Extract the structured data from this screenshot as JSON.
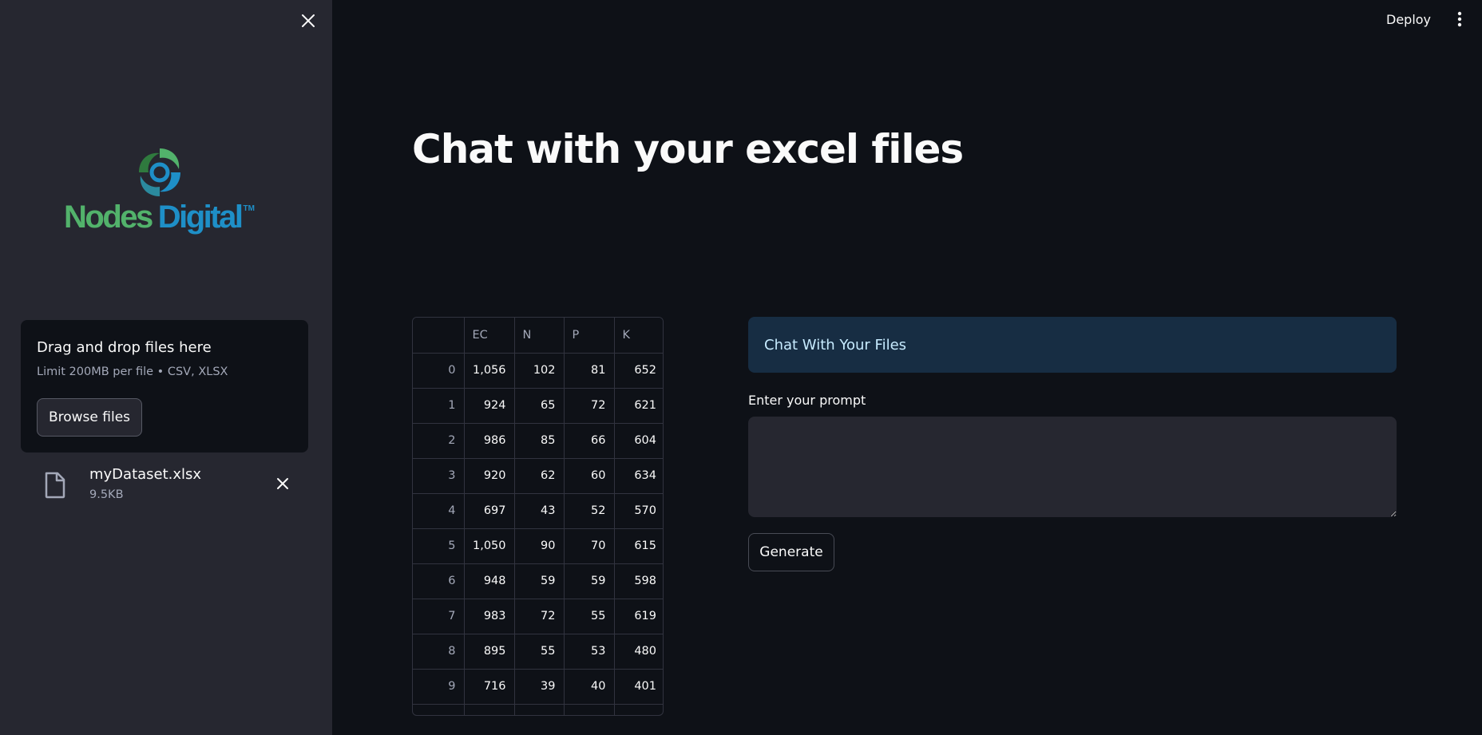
{
  "header": {
    "deploy_label": "Deploy"
  },
  "sidebar": {
    "logo": {
      "word1": "Nodes",
      "word2": "Digital",
      "tm": "TM"
    },
    "uploader": {
      "title": "Drag and drop files here",
      "subtitle": "Limit 200MB per file • CSV, XLSX",
      "browse_label": "Browse files"
    },
    "file": {
      "name": "myDataset.xlsx",
      "size": "9.5KB"
    }
  },
  "main": {
    "title": "Chat with your excel files",
    "table": {
      "columns": [
        "",
        "EC",
        "N",
        "P",
        "K"
      ],
      "rows": [
        [
          "0",
          "1,056",
          "102",
          "81",
          "652"
        ],
        [
          "1",
          "924",
          "65",
          "72",
          "621"
        ],
        [
          "2",
          "986",
          "85",
          "66",
          "604"
        ],
        [
          "3",
          "920",
          "62",
          "60",
          "634"
        ],
        [
          "4",
          "697",
          "43",
          "52",
          "570"
        ],
        [
          "5",
          "1,050",
          "90",
          "70",
          "615"
        ],
        [
          "6",
          "948",
          "59",
          "59",
          "598"
        ],
        [
          "7",
          "983",
          "72",
          "55",
          "619"
        ],
        [
          "8",
          "895",
          "55",
          "53",
          "480"
        ],
        [
          "9",
          "716",
          "39",
          "40",
          "401"
        ]
      ]
    },
    "chat_header": "Chat With Your Files",
    "prompt_label": "Enter your prompt",
    "prompt_value": "",
    "generate_label": "Generate"
  },
  "colors": {
    "background": "#0e1117",
    "sidebar": "#262730",
    "chat_header_bg": "#172d43",
    "chat_header_text": "#c7ebff",
    "logo_green": "#52b26b",
    "logo_blue": "#1e8fc7"
  }
}
